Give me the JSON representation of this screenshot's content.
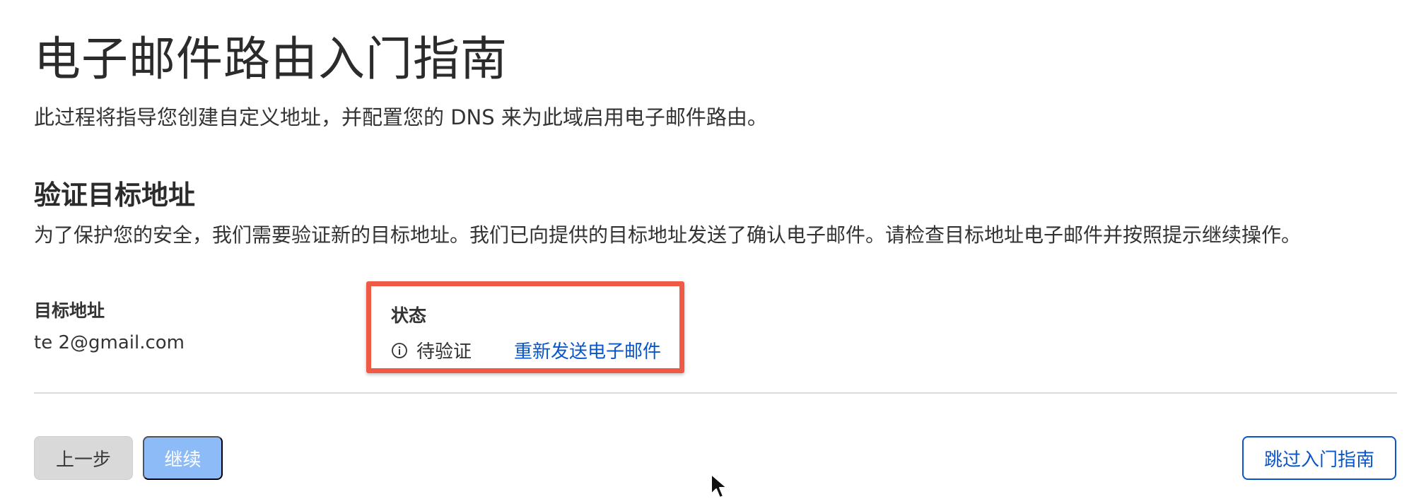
{
  "page": {
    "title": "电子邮件路由入门指南",
    "intro": "此过程将指导您创建自定义地址，并配置您的 DNS 来为此域启用电子邮件路由。"
  },
  "verify_section": {
    "title": "验证目标地址",
    "description": "为了保护您的安全，我们需要验证新的目标地址。我们已向提供的目标地址发送了确认电子邮件。请检查目标地址电子邮件并按照提示继续操作。"
  },
  "destination": {
    "header": "目标地址",
    "value": "te        2@gmail.com"
  },
  "status": {
    "header": "状态",
    "icon": "info-circle-icon",
    "value": "待验证",
    "resend_label": "重新发送电子邮件"
  },
  "buttons": {
    "prev_label": "上一步",
    "continue_label": "继续",
    "skip_label": "跳过入门指南"
  },
  "colors": {
    "link": "#0a55c8",
    "highlight_border": "#ee5a45",
    "continue_disabled": "#8dbbf7",
    "prev_bg": "#d9d9d9"
  }
}
